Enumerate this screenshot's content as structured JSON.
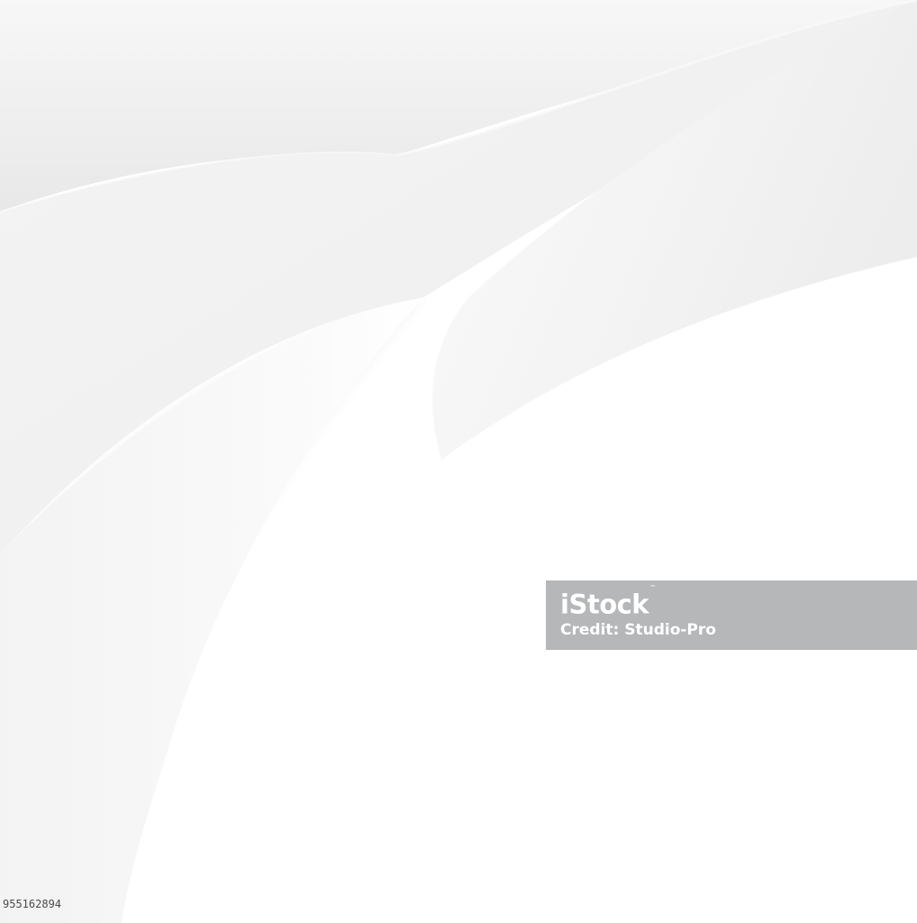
{
  "palette": {
    "background": "#ffffff",
    "shadow_gray": "#e6e6e6",
    "band_gray": "#b5b7b9",
    "watermark_text": "#ffffff"
  },
  "watermark": {
    "logo_text": "iStock",
    "logo_mark": "™",
    "credit": "Credit: Studio-Pro"
  },
  "image_id": "955162894"
}
